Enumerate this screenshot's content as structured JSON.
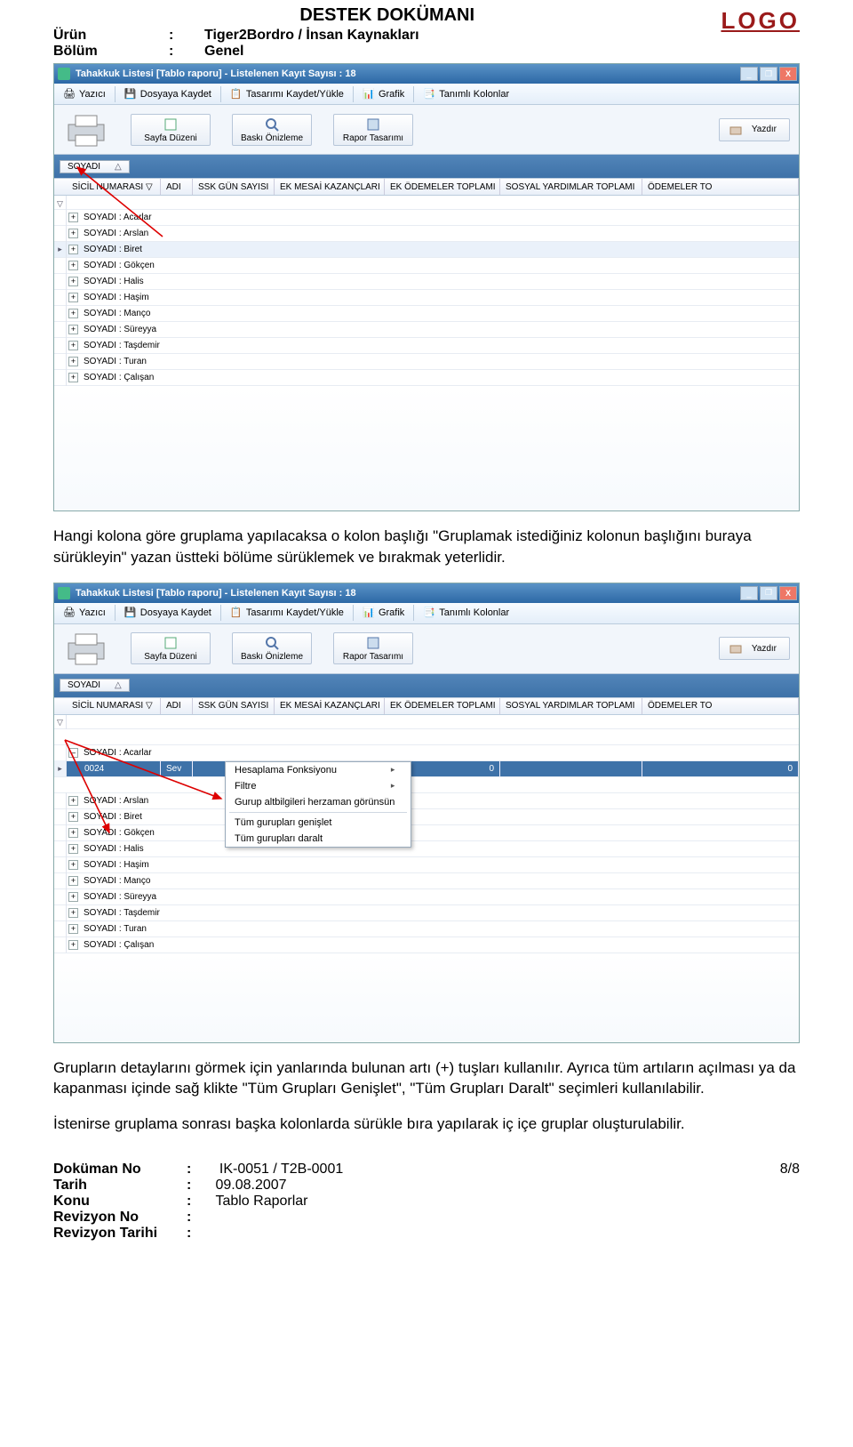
{
  "doc": {
    "title": "DESTEK DOKÜMANI",
    "product_label": "Ürün",
    "product_value": "Tiger2Bordro / İnsan Kaynakları",
    "section_label": "Bölüm",
    "section_value": "Genel",
    "logo_text": "LOGO"
  },
  "window": {
    "title_prefix": "Tahakkuk Listesi [Tablo raporu]  -  Listelenen Kayıt Sayısı : ",
    "record_count": "18"
  },
  "toolbar": {
    "printer": "Yazıcı",
    "save_file": "Dosyaya Kaydet",
    "save_design": "Tasarımı Kaydet/Yükle",
    "chart": "Grafik",
    "defined_cols": "Tanımlı Kolonlar"
  },
  "actions": {
    "page_layout": "Sayfa Düzeni",
    "print_preview": "Baskı Önizleme",
    "report_design": "Rapor Tasarımı",
    "print": "Yazdır"
  },
  "group_chip": {
    "label": "SOYADI",
    "sort": "△"
  },
  "columns": {
    "sicil": "SİCİL NUMARASI",
    "sort": "▽",
    "adi": "ADI",
    "ssk": "SSK GÜN SAYISI",
    "ekmesai": "EK MESAİ KAZANÇLARI",
    "ekodeme": "EK ÖDEMELER TOPLAMI",
    "sosyal": "SOSYAL YARDIMLAR TOPLAMI",
    "odemeler": "ÖDEMELER TO"
  },
  "groups_prefix": "SOYADI : ",
  "groups": [
    "Acarlar",
    "Arslan",
    "Biret",
    "Gökçen",
    "Halis",
    "Haşim",
    "Manço",
    "Süreyya",
    "Taşdemir",
    "Turan",
    "Çalışan"
  ],
  "paragraph1": "Hangi kolona göre gruplama yapılacaksa o kolon başlığı \"Gruplamak istediğiniz kolonun başlığını buraya sürükleyin\" yazan üstteki bölüme sürüklemek ve bırakmak yeterlidir.",
  "expanded": {
    "sicil": "0024",
    "adi_prefix": "Sev",
    "zero1": "0",
    "zero2": "0"
  },
  "context_menu": {
    "calc_fn": "Hesaplama Fonksiyonu",
    "filter": "Filtre",
    "show_sub": "Gurup altbilgileri herzaman görünsün",
    "expand_all": "Tüm gurupları genişlet",
    "collapse_all": "Tüm gurupları daralt"
  },
  "paragraph2": "Grupların detaylarını görmek için yanlarında bulunan artı (+) tuşları kullanılır. Ayrıca tüm artıların açılması ya da kapanması içinde sağ klikte \"Tüm Grupları Genişlet\", \"Tüm Grupları Daralt\" seçimleri kullanılabilir.",
  "paragraph3": "İstenirse gruplama sonrası başka kolonlarda sürükle bıra yapılarak iç içe gruplar oluşturulabilir.",
  "footer": {
    "docno_label": "Doküman No",
    "docno_value": "IK-0051  / T2B-0001",
    "date_label": "Tarih",
    "date_value": "09.08.2007",
    "subject_label": "Konu",
    "subject_value": "Tablo Raporlar",
    "revno_label": "Revizyon No",
    "revdate_label": "Revizyon Tarihi",
    "page": "8/8"
  },
  "expand_plus": "+",
  "collapse_minus": "–",
  "winbtns": {
    "min": "_",
    "max": "❐",
    "close": "X"
  }
}
